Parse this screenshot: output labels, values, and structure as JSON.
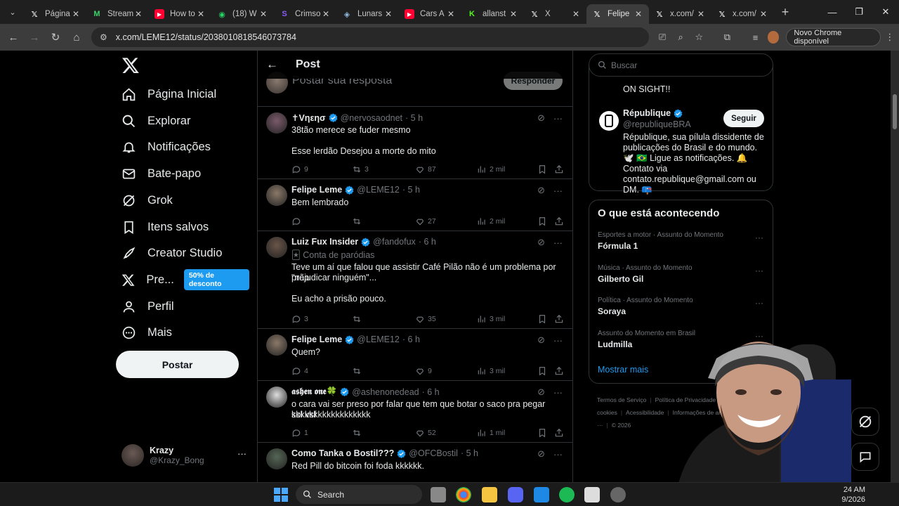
{
  "browser": {
    "tabs": [
      {
        "title": "Página",
        "icon": "x-icon",
        "favcolor": "#ffffff"
      },
      {
        "title": "Stream",
        "icon": "m-icon",
        "favcolor": "#3cd36b"
      },
      {
        "title": "How to",
        "icon": "youtube-icon",
        "favcolor": "#ff0033"
      },
      {
        "title": "(18) W",
        "icon": "whatsapp-icon",
        "favcolor": "#25d366"
      },
      {
        "title": "Crimso",
        "icon": "s-icon",
        "favcolor": "#8a5cf6"
      },
      {
        "title": "Lunars",
        "icon": "steam-icon",
        "favcolor": "#8fb8de"
      },
      {
        "title": "Cars A",
        "icon": "youtube-icon",
        "favcolor": "#ff0033"
      },
      {
        "title": "allanst",
        "icon": "kick-icon",
        "favcolor": "#53fc18"
      },
      {
        "title": "X",
        "icon": "x-icon",
        "favcolor": "#ffffff"
      },
      {
        "title": "Felipe",
        "icon": "x-icon",
        "favcolor": "#ffffff",
        "active": true
      },
      {
        "title": "x.com/",
        "icon": "x-icon",
        "favcolor": "#ffffff"
      },
      {
        "title": "x.com/",
        "icon": "x-icon",
        "favcolor": "#ffffff"
      }
    ],
    "url": "x.com/LEME12/status/2038010818546073784",
    "update_label": "Novo Chrome disponível"
  },
  "nav": {
    "items": [
      {
        "label": "Página Inicial",
        "icon": "home-icon"
      },
      {
        "label": "Explorar",
        "icon": "search-icon"
      },
      {
        "label": "Notificações",
        "icon": "bell-icon"
      },
      {
        "label": "Bate-papo",
        "icon": "mail-icon"
      },
      {
        "label": "Grok",
        "icon": "grok-icon"
      },
      {
        "label": "Itens salvos",
        "icon": "bookmark-icon"
      },
      {
        "label": "Creator Studio",
        "icon": "rocket-icon"
      },
      {
        "label": "Pre...",
        "icon": "x-icon",
        "badge": "50% de desconto"
      },
      {
        "label": "Perfil",
        "icon": "person-icon"
      },
      {
        "label": "Mais",
        "icon": "more-circle-icon"
      }
    ],
    "post_button": "Postar",
    "account": {
      "name": "Krazy",
      "handle": "@Krazy_Bong"
    }
  },
  "main": {
    "title": "Post",
    "reply_placeholder": "Postar sua resposta",
    "reply_button": "Responder",
    "tweets": [
      {
        "name": "✝Vηεησ",
        "handle": "@nervosaodnet",
        "time": "· 5 h",
        "lines": [
          "38tão merece se fuder mesmo",
          "",
          "Esse lerdão Desejou a morte do mito"
        ],
        "replies": "9",
        "retweets": "3",
        "likes": "87",
        "views": "2 mil",
        "avatar": "#7a5a6a"
      },
      {
        "name": "Felipe Leme",
        "handle": "@LEME12",
        "time": "· 5 h",
        "lines": [
          "Bem lembrado"
        ],
        "replies": "",
        "retweets": "",
        "likes": "27",
        "views": "2 mil",
        "avatar": "#8a7868"
      },
      {
        "name": "Luiz Fux Insider",
        "handle": "@fandofux",
        "time": "· 6 h",
        "sub": "🃏 Conta de paródias",
        "lines": [
          "Teve um aí que falou que assistir Café Pilão não é um problema por \"não",
          "prejudicar ninguém\"...",
          "",
          "Eu acho a prisão pouco."
        ],
        "replies": "3",
        "retweets": "",
        "likes": "35",
        "views": "3 mil",
        "avatar": "#6a5548"
      },
      {
        "name": "Felipe Leme",
        "handle": "@LEME12",
        "time": "· 6 h",
        "lines": [
          "Quem?"
        ],
        "replies": "4",
        "retweets": "",
        "likes": "9",
        "views": "3 mil",
        "avatar": "#8a7868"
      },
      {
        "name": "𝖆𝖘𝖍𝖊𝖓 𝖔𝖓𝖊🍀",
        "handle": "@ashenonedead",
        "time": "· 6 h",
        "lines": [
          "o cara vai ser preso por falar que tem que botar o saco pra pegar sol vsf",
          "kkkkkkkkkkkkkkkkkk"
        ],
        "replies": "1",
        "retweets": "",
        "likes": "52",
        "views": "1 mil",
        "avatar": "#dddddd"
      },
      {
        "name": "Como Tanka o Bostil???",
        "handle": "@OFCBostil",
        "time": "· 5 h",
        "lines": [
          "Red Pill do bitcoin foi foda kkkkkk."
        ],
        "replies": "",
        "retweets": "",
        "likes": "",
        "views": "",
        "avatar": "#556655"
      }
    ]
  },
  "sidebar": {
    "search_placeholder": "Buscar",
    "card": {
      "prev_text": "ON SIGHT!!",
      "name": "République",
      "handle": "@republiqueBRA",
      "follow": "Seguir",
      "bio": "République, sua pílula dissidente de publicações do Brasil e do mundo. 🕊️ 🇧🇷 Ligue as notificações. 🔔 Contato via contato.republique@gmail.com ou DM. 📪"
    },
    "trends_title": "O que está acontecendo",
    "trends": [
      {
        "category": "Esportes a motor · Assunto do Momento",
        "name": "Fórmula 1"
      },
      {
        "category": "Música · Assunto do Momento",
        "name": "Gilberto Gil"
      },
      {
        "category": "Política · Assunto do Momento",
        "name": "Soraya"
      },
      {
        "category": "Assunto do Momento em Brasil",
        "name": "Ludmilla"
      }
    ],
    "show_more": "Mostrar mais",
    "footer": [
      "Termos de Serviço",
      "Política de Privacidade",
      "Política de cookies",
      "Acessibilidade",
      "Informações de anúncios",
      "Mais ···",
      "© 2026"
    ]
  },
  "taskbar": {
    "search": "Search",
    "time": "24 AM",
    "date": "9/2026"
  },
  "colors": {
    "accent": "#1d9bf0",
    "verified": "#1d9bf0",
    "muted": "#71767b"
  }
}
